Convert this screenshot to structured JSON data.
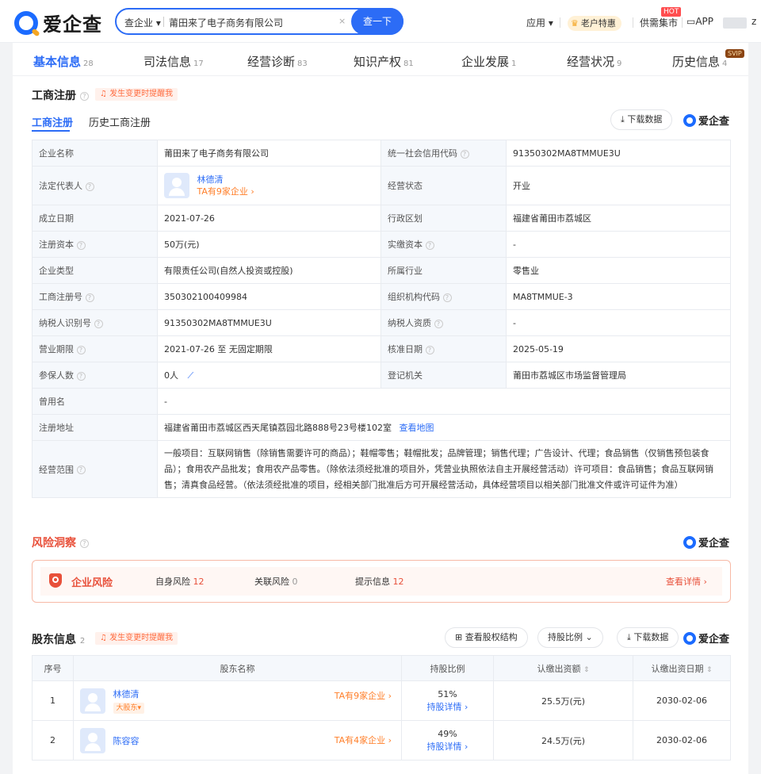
{
  "header": {
    "logo": "爱企查",
    "search_type": "查企业",
    "search_value": "莆田来了电子商务有限公司",
    "search_button": "查一下",
    "clear_icon": "×",
    "apps": "应用",
    "vip": "老户特惠",
    "supply": "供需集市",
    "hot": "HOT",
    "app": "APP",
    "user_suffix": "z"
  },
  "tabs": [
    {
      "label": "基本信息",
      "count": "28"
    },
    {
      "label": "司法信息",
      "count": "17"
    },
    {
      "label": "经营诊断",
      "count": "83"
    },
    {
      "label": "知识产权",
      "count": "81"
    },
    {
      "label": "企业发展",
      "count": "1"
    },
    {
      "label": "经营状况",
      "count": "9"
    },
    {
      "label": "历史信息",
      "count": "4"
    }
  ],
  "svip": "SVIP",
  "reg": {
    "title": "工商注册",
    "remind": "发生变更时提醒我",
    "subtab_current": "工商注册",
    "subtab_history": "历史工商注册",
    "download": "下载数据",
    "brand": "爱企查",
    "company_name_label": "企业名称",
    "company_name": "莆田来了电子商务有限公司",
    "credit_code_label": "统一社会信用代码",
    "credit_code": "91350302MA8TMMUE3U",
    "legal_rep_label": "法定代表人",
    "legal_rep": "林德清",
    "legal_rep_companies": "TA有9家企业",
    "status_label": "经营状态",
    "status": "开业",
    "found_date_label": "成立日期",
    "found_date": "2021-07-26",
    "region_label": "行政区划",
    "region": "福建省莆田市荔城区",
    "capital_label": "注册资本",
    "capital": "50万(元)",
    "paid_capital_label": "实缴资本",
    "paid_capital": "-",
    "type_label": "企业类型",
    "type": "有限责任公司(自然人投资或控股)",
    "industry_label": "所属行业",
    "industry": "零售业",
    "reg_no_label": "工商注册号",
    "reg_no": "350302100409984",
    "org_code_label": "组织机构代码",
    "org_code": "MA8TMMUE-3",
    "tax_id_label": "纳税人识别号",
    "tax_id": "91350302MA8TMMUE3U",
    "tax_qual_label": "纳税人资质",
    "tax_qual": "-",
    "term_label": "营业期限",
    "term": "2021-07-26 至 无固定期限",
    "approve_date_label": "核准日期",
    "approve_date": "2025-05-19",
    "insured_label": "参保人数",
    "insured": "0人",
    "authority_label": "登记机关",
    "authority": "莆田市荔城区市场监督管理局",
    "former_name_label": "曾用名",
    "former_name": "-",
    "address_label": "注册地址",
    "address": "福建省莆田市荔城区西天尾镇荔园北路888号23号楼102室",
    "map_link": "查看地图",
    "scope_label": "经营范围",
    "scope": "一般项目：互联网销售（除销售需要许可的商品）；鞋帽零售；鞋帽批发；品牌管理；销售代理；广告设计、代理；食品销售（仅销售预包装食品）；食用农产品批发；食用农产品零售。（除依法须经批准的项目外，凭营业执照依法自主开展经营活动）许可项目：食品销售；食品互联网销售；清真食品经营。（依法须经批准的项目，经相关部门批准后方可开展经营活动，具体经营项目以相关部门批准文件或许可证件为准）"
  },
  "risk": {
    "title": "风险洞察",
    "brand": "爱企查",
    "label": "企业风险",
    "self_label": "自身风险",
    "self_count": "12",
    "related_label": "关联风险",
    "related_count": "0",
    "hint_label": "提示信息",
    "hint_count": "12",
    "detail": "查看详情"
  },
  "holders": {
    "title": "股东信息",
    "count": "2",
    "remind": "发生变更时提醒我",
    "structure_btn": "查看股权结构",
    "ratio_btn": "持股比例",
    "download": "下载数据",
    "brand": "爱企查",
    "columns": [
      "序号",
      "股东名称",
      "持股比例",
      "认缴出资额",
      "认缴出资日期"
    ],
    "rows": [
      {
        "no": "1",
        "name": "林德清",
        "tag": "大股东",
        "companies": "TA有9家企业",
        "ratio": "51%",
        "ratio_link": "持股详情",
        "amount": "25.5万(元)",
        "date": "2030-02-06"
      },
      {
        "no": "2",
        "name": "陈容容",
        "tag": "",
        "companies": "TA有4家企业",
        "ratio": "49%",
        "ratio_link": "持股详情",
        "amount": "24.5万(元)",
        "date": "2030-02-06"
      }
    ]
  },
  "icons": {
    "help": "question-circle-icon",
    "bell": "bell-icon",
    "download": "download-icon",
    "chart": "trend-chart-icon",
    "arrow": "chevron-right-icon"
  }
}
